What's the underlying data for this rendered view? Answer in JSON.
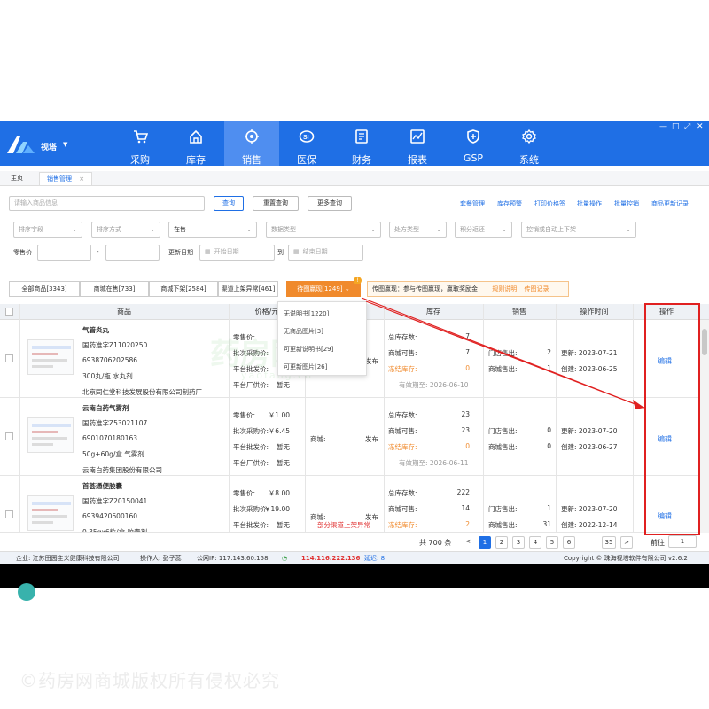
{
  "app": {
    "brand": "视塔"
  },
  "nav": [
    {
      "label": "采购",
      "icon": "cart-icon"
    },
    {
      "label": "库存",
      "icon": "home-icon"
    },
    {
      "label": "销售",
      "icon": "target-icon",
      "active": true
    },
    {
      "label": "医保",
      "icon": "si-badge-icon"
    },
    {
      "label": "财务",
      "icon": "document-icon"
    },
    {
      "label": "报表",
      "icon": "chart-icon"
    },
    {
      "label": "GSP",
      "icon": "shield-plus-icon"
    },
    {
      "label": "系统",
      "icon": "gear-icon"
    }
  ],
  "window_controls": [
    "—",
    "□",
    "⤢",
    "✕"
  ],
  "tabs": {
    "home": "主页",
    "sales": "销售管理",
    "close": "×"
  },
  "search": {
    "placeholder": "请输入商品信息",
    "query_btn": "查询",
    "reset_btn": "重置查询",
    "more_btn": "更多查询",
    "links": [
      "套餐管理",
      "库存预警",
      "打印价格签",
      "批量操作",
      "批量控销",
      "商品更新记录"
    ]
  },
  "filters": {
    "sort_field": "排序字段",
    "sort_mode": "排序方式",
    "status": "在售",
    "data_type": "数据类型",
    "rx_type": "处方类型",
    "points": "积分返还",
    "control": "控销或自动上下架",
    "retail_label": "零售价",
    "dash": "-",
    "update_label": "更新日期",
    "start_date": "开始日期",
    "to": "到",
    "end_date": "结束日期"
  },
  "status_tabs": {
    "all": "全部商品[3343]",
    "mall_on": "商城在售[733]",
    "mall_off": "商城下架[2584]",
    "channel": "渠道上架异常[461]",
    "pending_img": "待图赢现[1249]",
    "badge": "!"
  },
  "notice": {
    "text": "传图赢现：参与传图赢现，赢取奖励金",
    "rule": "规则说明",
    "record": "传图记录"
  },
  "dropdown": [
    "无说明书[1220]",
    "无商品图片[3]",
    "可更新说明书[29]",
    "可更新图片[26]"
  ],
  "table_headers": {
    "goods": "商品",
    "price": "价格/元",
    "stock": "库存",
    "sales": "销售",
    "time": "操作时间",
    "op": "操作"
  },
  "rows": [
    {
      "name": "气管炎丸",
      "approval": "国药准字Z11020250",
      "barcode": "6938706202586",
      "spec": "300丸/瓶 水丸剂",
      "maker": "北京同仁堂科技发展股份有限公司制药厂",
      "prices": {
        "retail_l": "零售价:",
        "retail_v": "",
        "batch_l": "批次采购价:",
        "batch_v": "",
        "plat_l": "平台批发价:",
        "plat_v": "暂无",
        "mfr_l": "平台厂供价:",
        "mfr_v": "暂无"
      },
      "mall": {
        "label": "",
        "value": "发布",
        "note": ""
      },
      "stock": {
        "total_l": "总库存数:",
        "total_v": "7",
        "avail_l": "商城可售:",
        "avail_v": "7",
        "frozen_l": "冻结库存:",
        "frozen_v": "0",
        "expiry": "有效期至: 2026-06-10"
      },
      "sales": {
        "store_l": "门店售出:",
        "store_v": "2",
        "mall_l": "商城售出:",
        "mall_v": "1"
      },
      "time": {
        "update": "更新: 2023-07-21",
        "create": "创建: 2023-06-25"
      },
      "op": "编辑"
    },
    {
      "name": "云南白药气雾剂",
      "approval": "国药准字Z53021107",
      "barcode": "6901070180163",
      "spec": "50g+60g/盒 气雾剂",
      "maker": "云南白药集团股份有限公司",
      "prices": {
        "retail_l": "零售价:",
        "retail_v": "￥1.00",
        "batch_l": "批次采购价:",
        "batch_v": "￥6.45",
        "plat_l": "平台批发价:",
        "plat_v": "暂无",
        "mfr_l": "平台厂供价:",
        "mfr_v": "暂无"
      },
      "mall": {
        "label": "商城:",
        "value": "发布",
        "note": ""
      },
      "stock": {
        "total_l": "总库存数:",
        "total_v": "23",
        "avail_l": "商城可售:",
        "avail_v": "23",
        "frozen_l": "冻结库存:",
        "frozen_v": "0",
        "expiry": "有效期至: 2026-06-11"
      },
      "sales": {
        "store_l": "门店售出:",
        "store_v": "0",
        "mall_l": "商城售出:",
        "mall_v": "0"
      },
      "time": {
        "update": "更新: 2023-07-20",
        "create": "创建: 2023-06-27"
      },
      "op": "编辑"
    },
    {
      "name": "首荟通便胶囊",
      "approval": "国药准字Z20150041",
      "barcode": "6939420600160",
      "spec": "0.35gx6粒/盒 胶囊剂",
      "maker": "",
      "prices": {
        "retail_l": "零售价:",
        "retail_v": "￥8.00",
        "batch_l": "批次采购价:",
        "batch_v": "￥19.00",
        "plat_l": "平台批发价:",
        "plat_v": "暂无",
        "mfr_l": "",
        "mfr_v": ""
      },
      "mall": {
        "label": "商城:",
        "value": "发布",
        "note": "部分渠道上架异常"
      },
      "stock": {
        "total_l": "总库存数:",
        "total_v": "222",
        "avail_l": "商城可售:",
        "avail_v": "14",
        "frozen_l": "冻结库存:",
        "frozen_v": "2",
        "expiry": ""
      },
      "sales": {
        "store_l": "门店售出:",
        "store_v": "1",
        "mall_l": "商城售出:",
        "mall_v": "31"
      },
      "time": {
        "update": "更新: 2023-07-20",
        "create": "创建: 2022-12-14"
      },
      "op": "编辑"
    }
  ],
  "pagination": {
    "total": "共 700 条",
    "prev": "<",
    "pages": [
      "1",
      "2",
      "3",
      "4",
      "5",
      "6"
    ],
    "dots": "···",
    "last": "35",
    "next": ">",
    "goto_label": "前往",
    "goto_value": "1"
  },
  "footer": {
    "company": "企业: 江苏田园主义健康科技有限公司",
    "operator": "操作人: 彭子蕊",
    "public_ip": "公网IP: 117.143.60.158",
    "ip2": "114.116.222.136",
    "ping": "延迟: 8",
    "copyright": "Copyright © 珠海视塔软件有限公司 v2.6.2"
  },
  "watermarks": {
    "center": "药房网商城",
    "center_sub": "yaofang.cn",
    "bottom": "©药房网商城版权所有侵权必究"
  },
  "colors": {
    "primary": "#1f6fe5",
    "accent": "#f08a2c",
    "danger": "#e02020"
  }
}
